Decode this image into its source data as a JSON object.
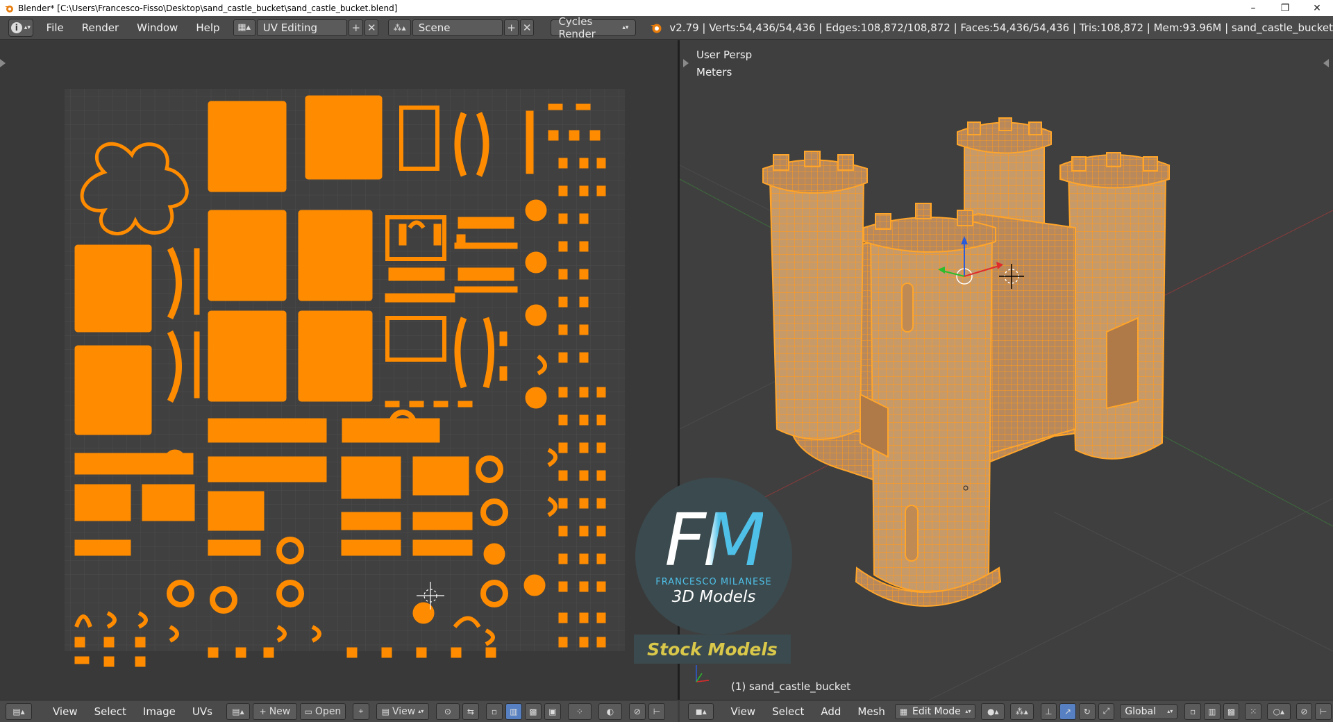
{
  "window": {
    "title": "Blender* [C:\\Users\\Francesco-Fisso\\Desktop\\sand_castle_bucket\\sand_castle_bucket.blend]",
    "controls": {
      "minimize": "–",
      "restore": "❐",
      "close": "✕"
    }
  },
  "topbar": {
    "editor_icon": "i",
    "menus": [
      "File",
      "Render",
      "Window",
      "Help"
    ],
    "workspace": "UV Editing",
    "scene": "Scene",
    "render_engine": "Cycles Render",
    "stats": "v2.79 | Verts:54,436/54,436 | Edges:108,872/108,872 | Faces:54,436/54,436 | Tris:108,872 | Mem:93.96M | sand_castle_bucket"
  },
  "viewport": {
    "view_name": "User Persp",
    "units": "Meters",
    "object_label": "(1) sand_castle_bucket"
  },
  "uv_footer": {
    "menus": [
      "View",
      "Select",
      "Image",
      "UVs"
    ],
    "new_label": "New",
    "open_label": "Open",
    "view_label": "View"
  },
  "view3d_footer": {
    "menus": [
      "View",
      "Select",
      "Add",
      "Mesh"
    ],
    "mode": "Edit Mode",
    "orientation": "Global"
  },
  "watermark": {
    "letters": "FM",
    "name": "FRANCESCO MILANESE",
    "subtitle": "3D Models",
    "stock": "Stock Models"
  },
  "colors": {
    "uv_island": "#ff8c00",
    "mesh_wire": "#ffa52a",
    "grid_bg": "#404040",
    "accent_blue": "#5680c2",
    "fm_blue": "#4fc1e9",
    "stock_yellow": "#d9c84a"
  }
}
